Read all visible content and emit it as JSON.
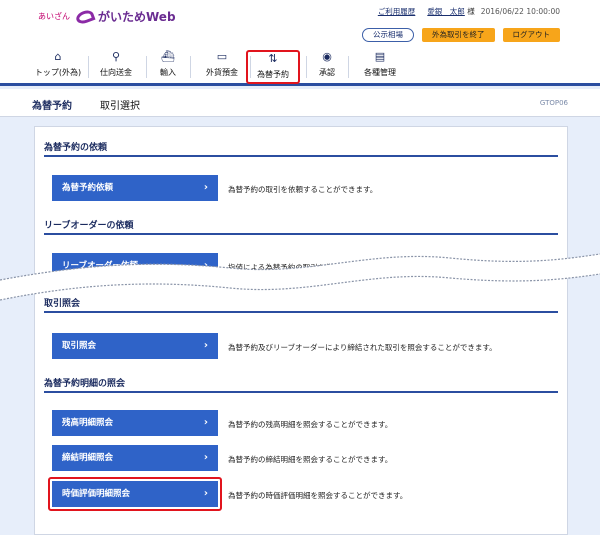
{
  "header": {
    "brand_small": "あいざん",
    "brand_name": "がいためWeb",
    "util": {
      "history_link": "ご利用履歴",
      "user_name": "愛銀　太郎",
      "user_suffix": "様",
      "datetime": "2016/06/22 10:00:00"
    },
    "buttons": {
      "public_rate": "公示相場",
      "end_fx": "外為取引を終了",
      "logout": "ログアウト"
    }
  },
  "nav": {
    "items": [
      {
        "label": "トップ(外為)",
        "icon": "home-icon"
      },
      {
        "label": "仕向送金",
        "icon": "remittance-icon"
      },
      {
        "label": "輸入",
        "icon": "import-ship-icon"
      },
      {
        "label": "外貨預金",
        "icon": "deposit-icon"
      },
      {
        "label": "為替予約",
        "icon": "forward-contract-icon"
      },
      {
        "label": "承認",
        "icon": "approval-icon"
      },
      {
        "label": "各種管理",
        "icon": "management-icon"
      }
    ]
  },
  "page": {
    "title": "為替予約",
    "subtitle": "取引選択",
    "code": "GTOP06"
  },
  "sections": [
    {
      "title": "為替予約の依頼",
      "items": [
        {
          "label": "為替予約依頼",
          "desc": "為替予約の取引を依頼することができます。"
        }
      ]
    },
    {
      "title": "リーブオーダーの依頼",
      "items": [
        {
          "label": "リーブオーダー依頼",
          "desc": "指値による為替予約の取引を依頼することができます。"
        }
      ]
    },
    {
      "title": "取引照会",
      "items": [
        {
          "label": "取引照会",
          "desc": "為替予約及びリーブオーダーにより締結された取引を照会することができます。"
        }
      ]
    },
    {
      "title": "為替予約明細の照会",
      "items": [
        {
          "label": "残高明細照会",
          "desc": "為替予約の残高明細を照会することができます。"
        },
        {
          "label": "締結明細照会",
          "desc": "為替予約の締結明細を照会することができます。"
        },
        {
          "label": "時価評価明細照会",
          "desc": "為替予約の時価評価明細を照会することができます。"
        }
      ]
    }
  ],
  "colors": {
    "primary": "#2f63c8",
    "navy": "#1b2b5f",
    "highlight": "#e1141d",
    "accent_orange": "#f7a51a",
    "page_bg": "#e7eefa"
  }
}
